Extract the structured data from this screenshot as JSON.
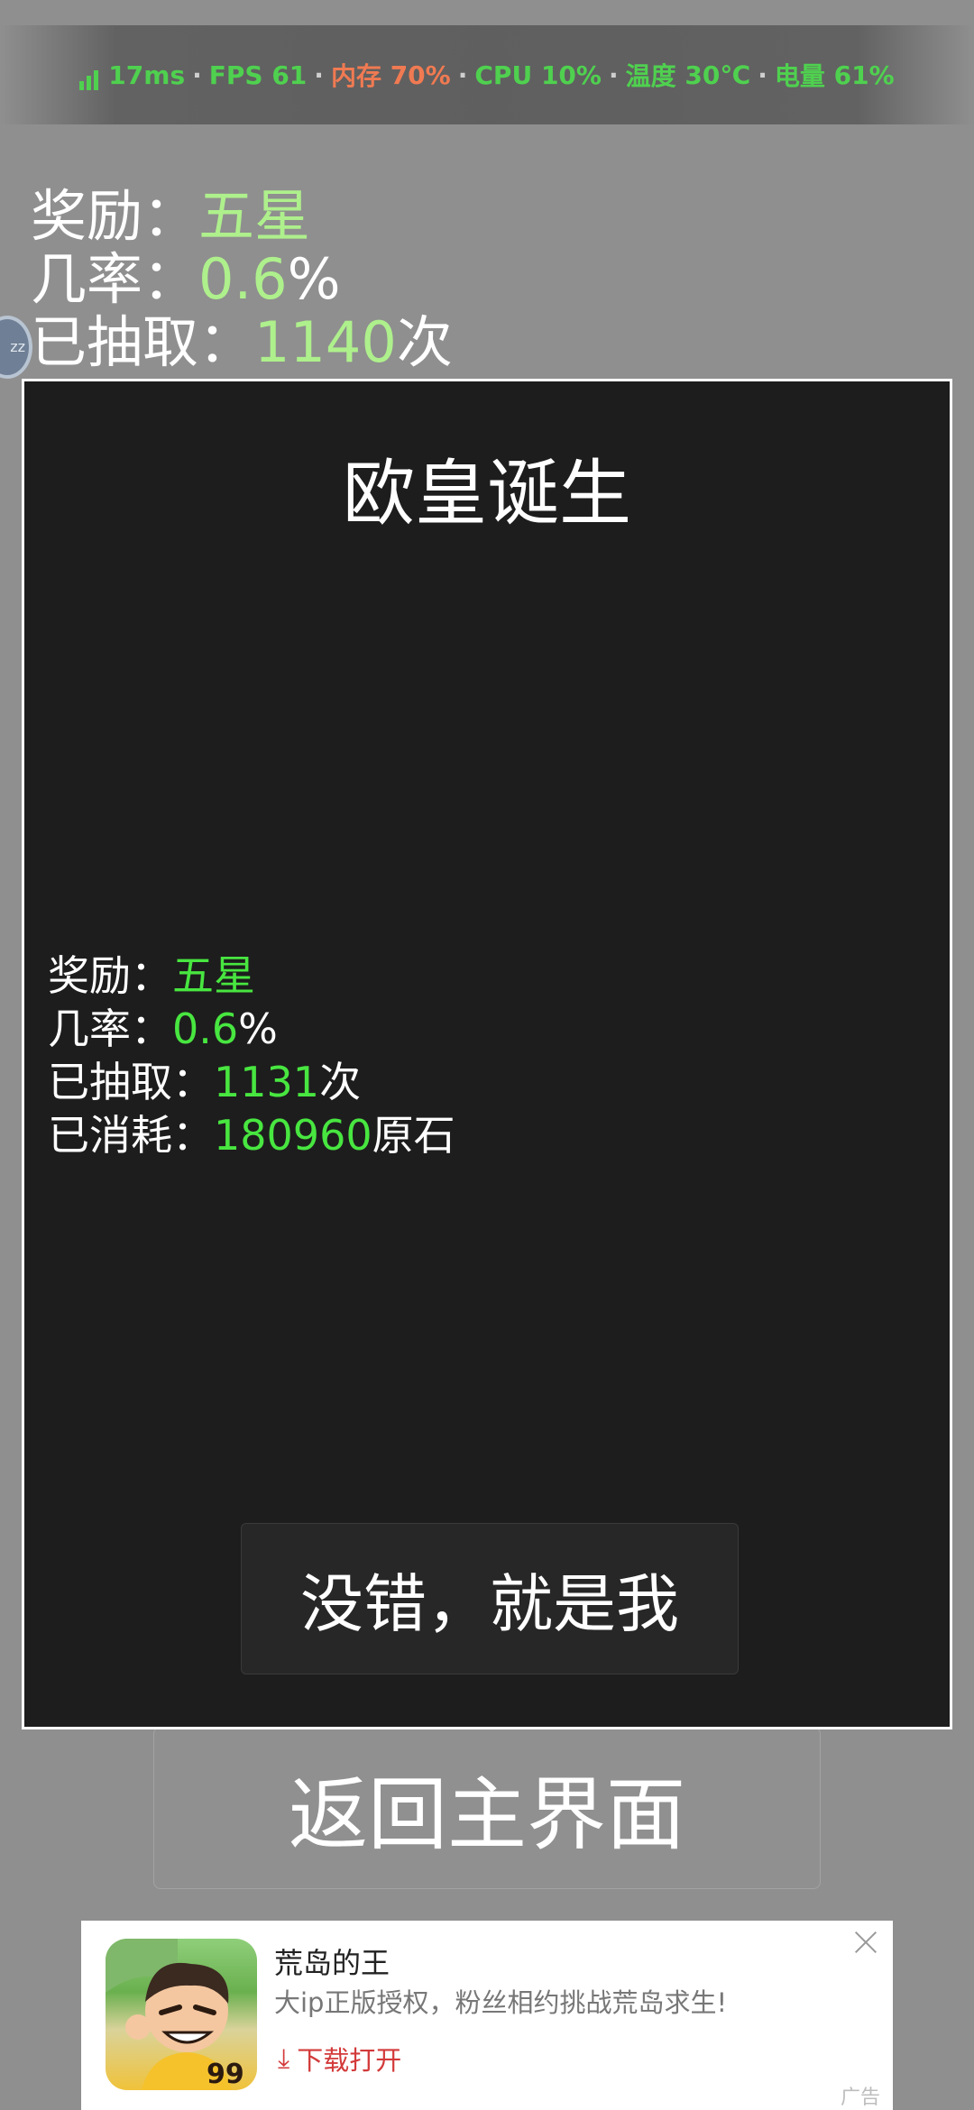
{
  "perf": {
    "latency": "17ms",
    "fps_label": "FPS",
    "fps": "61",
    "mem_label": "内存",
    "mem": "70%",
    "cpu_label": "CPU",
    "cpu": "10%",
    "temp_label": "温度",
    "temp": "30℃",
    "battery_label": "电量",
    "battery": "61%",
    "sep": "·"
  },
  "background_stats": {
    "reward_label": "奖励：",
    "reward_value": "五星",
    "rate_label": "几率：",
    "rate_value": "0.6",
    "rate_unit": "%",
    "draws_label": "已抽取：",
    "draws_value": "1140",
    "draws_unit": "次"
  },
  "floating_ball": {
    "text": "zz"
  },
  "back_button": {
    "label": "返回主界面"
  },
  "dialog": {
    "title": "欧皇诞生",
    "reward_label": "奖励：",
    "reward_value": "五星",
    "rate_label": "几率：",
    "rate_value": "0.6",
    "rate_unit": "%",
    "draws_label": "已抽取：",
    "draws_value": "1131",
    "draws_unit": "次",
    "cost_label": "已消耗：",
    "cost_value": "180960",
    "cost_unit": "原石",
    "confirm_label": "没错，就是我"
  },
  "ad": {
    "title": "荒岛的王",
    "description": "大ip正版授权，粉丝相约挑战荒岛求生!",
    "download_label": "下载打开",
    "tag": "广告",
    "icon": "cartoon-character-icon"
  }
}
